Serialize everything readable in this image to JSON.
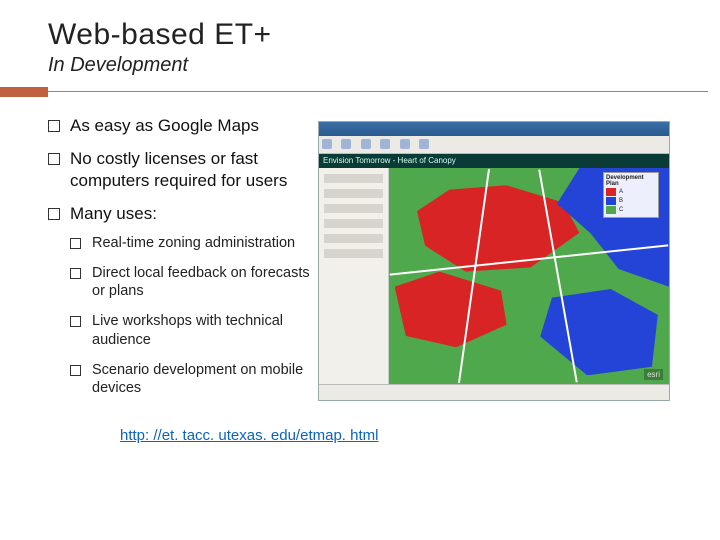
{
  "title": "Web-based ET+",
  "subtitle": "In Development",
  "bullets": [
    "As easy as Google Maps",
    "No costly licenses or fast computers required for users",
    "Many uses:"
  ],
  "sub_bullets": [
    "Real-time zoning administration",
    "Direct local feedback on forecasts or plans",
    "Live workshops with technical audience",
    "Scenario development on mobile devices"
  ],
  "link_text": "http: //et. tacc. utexas. edu/etmap. html",
  "mock": {
    "banner": "Envision Tomorrow - Heart of Canopy",
    "legend_title": "Development Plan",
    "legend": [
      {
        "color": "#d82424",
        "label": "A"
      },
      {
        "color": "#2344d6",
        "label": "B"
      },
      {
        "color": "#50a84c",
        "label": "C"
      }
    ],
    "watermark": "esri"
  }
}
